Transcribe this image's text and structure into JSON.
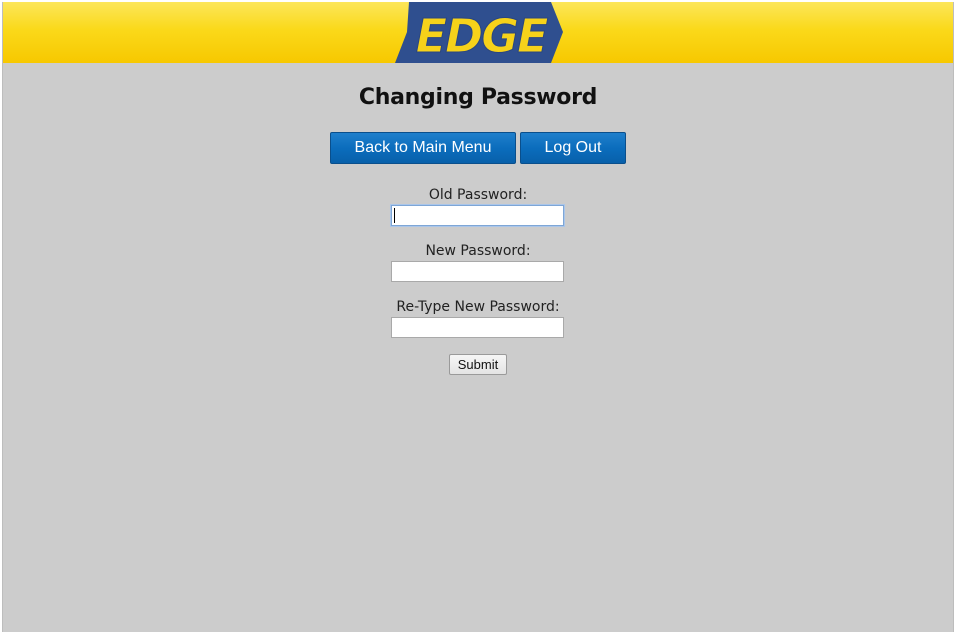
{
  "header": {
    "logo_text": "EDGE",
    "colors": {
      "banner_top": "#fce65a",
      "banner_bottom": "#f7c800",
      "logo_blue": "#2f4f8f",
      "logo_yellow": "#f6d21a"
    }
  },
  "page": {
    "title": "Changing Password",
    "background": "#cccccc"
  },
  "nav": {
    "back_label": "Back to Main Menu",
    "logout_label": "Log Out",
    "button_color": "#0b6dbd"
  },
  "form": {
    "old_password_label": "Old Password:",
    "old_password_value": "",
    "new_password_label": "New Password:",
    "new_password_value": "",
    "retype_password_label": "Re-Type New Password:",
    "retype_password_value": "",
    "submit_label": "Submit"
  }
}
